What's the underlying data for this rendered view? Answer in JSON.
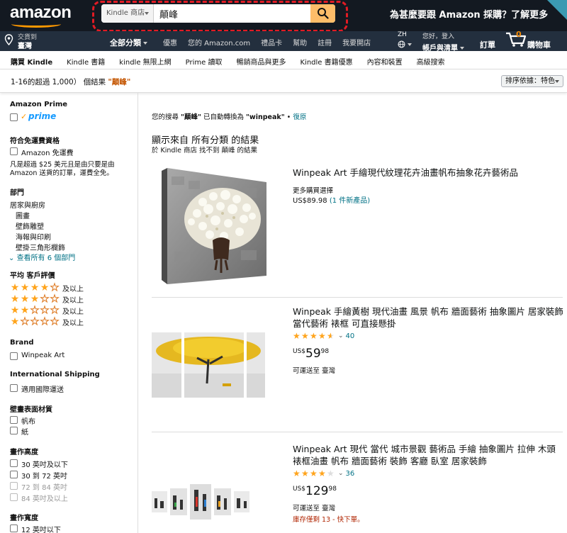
{
  "header": {
    "logo_text": "amazon",
    "search": {
      "category": "Kindle 商店",
      "query": "顛峰"
    },
    "promo": "為甚麼要跟 Amazon 採購？了解更多",
    "deliver": {
      "line1": "交貨到",
      "line2": "臺灣"
    },
    "all_categories": "全部分類",
    "nav_links": [
      "優惠",
      "您的 Amazon.com",
      "禮品卡",
      "幫助",
      "註冊",
      "我要開店"
    ],
    "language": "ZH",
    "account": {
      "line1": "您好，登入",
      "line2": "帳戶與清單"
    },
    "orders": "訂單",
    "cart": {
      "count": "0",
      "label": "購物車"
    }
  },
  "subnav": [
    "購買 Kindle",
    "Kindle 書籍",
    "kindle 無限上網",
    "Prime 讀取",
    "暢銷商品與更多",
    "Kindle 書籍優惠",
    "內容和裝置",
    "高級搜索"
  ],
  "results": {
    "count_text": "1-16的超過 1,000） 個結果 ",
    "query": "\"顛峰\"",
    "sort_label": "排序依據：特色"
  },
  "sidebar": {
    "prime_heading": "Amazon Prime",
    "prime_word": "prime",
    "free_ship_heading": "符合免運費資格",
    "free_ship_option": "Amazon 免運費",
    "free_ship_note1": "凡是超過 $25 美元且是由只要是由",
    "free_ship_note2": "Amazon 送貨的訂單，運費全免。",
    "dept_heading": "部門",
    "dept_root": "居家與廚房",
    "depts": [
      "圖畫",
      "壁飾雕塑",
      "海報與印刷",
      "壁掛三角形欄飾"
    ],
    "see_all": "查看所有 6 個部門",
    "rating_heading": "平均 客戶評價",
    "rating_up": "及以上",
    "ratings": [
      4,
      3,
      2,
      1
    ],
    "brand_heading": "Brand",
    "brand_option": "Winpeak Art",
    "intl_heading": "International Shipping",
    "intl_option": "適用國際運送",
    "surface_heading": "壁畫表面材質",
    "surfaces": [
      "帆布",
      "紙"
    ],
    "height_heading": "畫作高度",
    "heights": [
      "30 英吋及以下",
      "30 到 72 英吋",
      "72 到 84 英吋",
      "84 英吋及以上"
    ],
    "width_heading": "畫作寬度",
    "widths": [
      "12 英吋以下"
    ]
  },
  "notice": {
    "prefix": "您的搜尋 ",
    "original": "\"顛峰\"",
    "middle": " 已自動轉換為 ",
    "converted": "\"winpeak\"",
    "sep": " • ",
    "undo": "復原"
  },
  "showing": "顯示來自 所有分類 的結果",
  "notfound": "於 Kindle 商店 找不到 顛峰 的結果",
  "products": [
    {
      "brand": "Winpeak Art",
      "title": " 手繪現代紋理花卉油畫帆布抽象花卉藝術品",
      "more": "更多購買選擇",
      "price_text": "US$89.98 ",
      "offers": "(1 件新產品)"
    },
    {
      "brand": "Winpeak",
      "title": " 手繪黃樹 現代油畫 風景 帆布 牆面藝術 抽象圖片 居家裝飾 當代藝術 裱框 可直接懸掛",
      "rating": 4.5,
      "reviews": "40",
      "currency": "US$",
      "whole": "59",
      "frac": "98",
      "ship": "可運送至 臺灣"
    },
    {
      "brand": "Winpeak Art",
      "title": " 現代 當代 城市景觀 藝術品 手繪 抽象圖片 拉伸 木頭 裱框油畫 帆布 牆面藝術 裝飾 客廳 臥室 居家裝飾",
      "rating": 4,
      "reviews": "36",
      "currency": "US$",
      "whole": "129",
      "frac": "98",
      "ship": "可運送至 臺灣",
      "stock": "庫存僅剩 13 - 快下單。"
    }
  ],
  "colors": {
    "nav_dark": "#131921",
    "nav_mid": "#232f3e",
    "search_button": "#febd69",
    "link": "#007185",
    "star": "#ffa41c",
    "alert": "#b12704",
    "highlight_ring": "#e21b24"
  }
}
